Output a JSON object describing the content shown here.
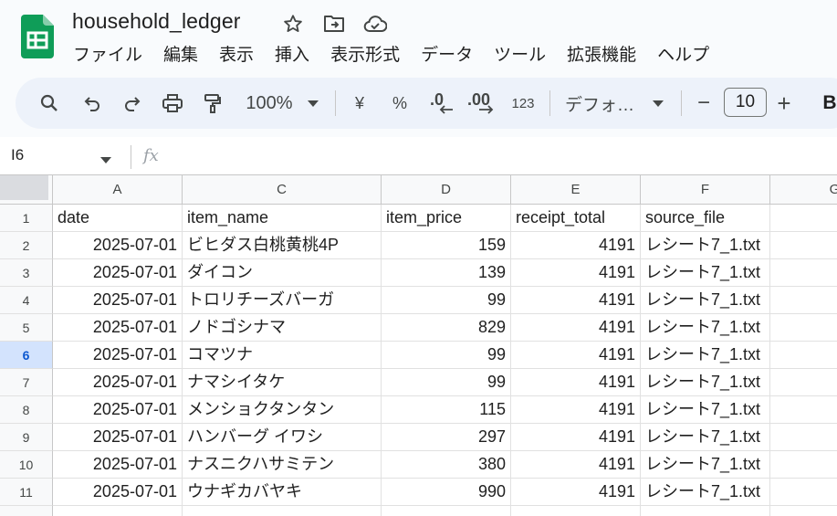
{
  "app": {
    "doc_title": "household_ledger",
    "title_icons": [
      "star-icon",
      "move-to-folder-icon",
      "cloud-status-icon"
    ]
  },
  "menu": [
    "ファイル",
    "編集",
    "表示",
    "挿入",
    "表示形式",
    "データ",
    "ツール",
    "拡張機能",
    "ヘルプ"
  ],
  "toolbar": {
    "zoom": "100%",
    "currency": "¥",
    "percent": "%",
    "decrease_decimal": ".0",
    "increase_decimal": ".00",
    "number_format": "123",
    "font": "デフォ…",
    "font_size": "10",
    "minus": "−",
    "plus": "+",
    "bold": "B"
  },
  "formula_bar": {
    "cell_ref": "I6",
    "fx": "fx",
    "content": ""
  },
  "sheet": {
    "columns": [
      "A",
      "C",
      "D",
      "E",
      "F",
      "G"
    ],
    "rows": [
      {
        "n": "1",
        "cells": [
          "date",
          "item_name",
          "item_price",
          "receipt_total",
          "source_file"
        ]
      },
      {
        "n": "2",
        "cells": [
          "2025-07-01",
          "ビヒダス白桃黄桃4P",
          "159",
          "4191",
          "レシート7_1.txt"
        ]
      },
      {
        "n": "3",
        "cells": [
          "2025-07-01",
          "ダイコン",
          "139",
          "4191",
          "レシート7_1.txt"
        ]
      },
      {
        "n": "4",
        "cells": [
          "2025-07-01",
          "トロリチーズバーガ",
          "99",
          "4191",
          "レシート7_1.txt"
        ]
      },
      {
        "n": "5",
        "cells": [
          "2025-07-01",
          "ノドゴシナマ",
          "829",
          "4191",
          "レシート7_1.txt"
        ]
      },
      {
        "n": "6",
        "cells": [
          "2025-07-01",
          "コマツナ",
          "99",
          "4191",
          "レシート7_1.txt"
        ]
      },
      {
        "n": "7",
        "cells": [
          "2025-07-01",
          "ナマシイタケ",
          "99",
          "4191",
          "レシート7_1.txt"
        ]
      },
      {
        "n": "8",
        "cells": [
          "2025-07-01",
          "メンショクタンタン",
          "115",
          "4191",
          "レシート7_1.txt"
        ]
      },
      {
        "n": "9",
        "cells": [
          "2025-07-01",
          "ハンバーグ イワシ",
          "297",
          "4191",
          "レシート7_1.txt"
        ]
      },
      {
        "n": "10",
        "cells": [
          "2025-07-01",
          "ナスニクハサミテン",
          "380",
          "4191",
          "レシート7_1.txt"
        ]
      },
      {
        "n": "11",
        "cells": [
          "2025-07-01",
          "ウナギカバヤキ",
          "990",
          "4191",
          "レシート7_1.txt"
        ]
      }
    ],
    "active_row": "6",
    "colors": {
      "accent": "#0b57d0",
      "active_header": "#d3e3fd",
      "sheets_green": "#0f9d58"
    }
  }
}
